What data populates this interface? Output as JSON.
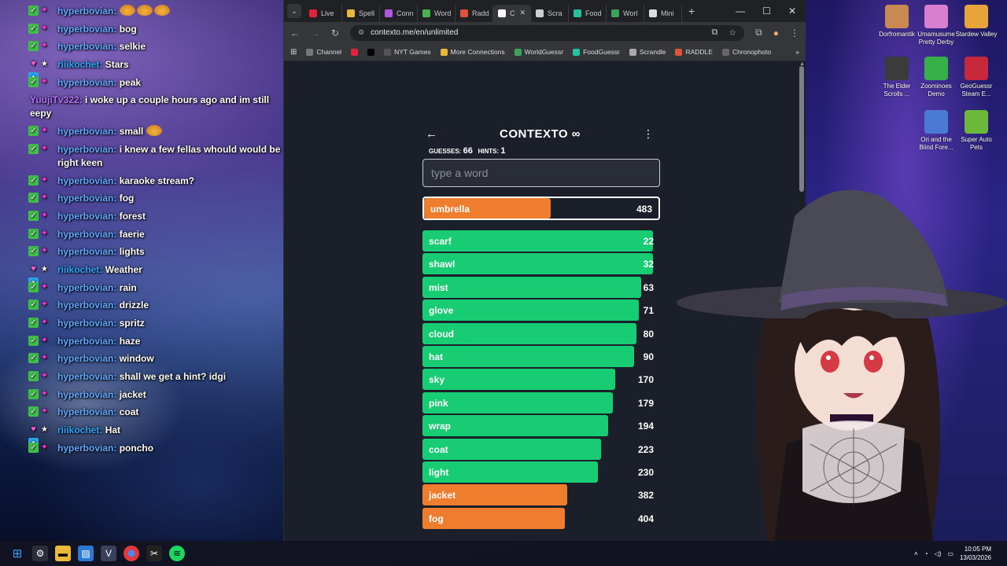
{
  "chat": {
    "messages": [
      {
        "user": "hyperbovian:",
        "text": "",
        "emote": true,
        "badges": "check-sub"
      },
      {
        "user": "hyperbovian:",
        "text": "bog",
        "badges": "check-sub"
      },
      {
        "user": "hyperbovian:",
        "text": "selkie",
        "badges": "check-sub"
      },
      {
        "user": "riiikochet:",
        "text": "Stars",
        "badges": "heart-star-vip"
      },
      {
        "user": "hyperbovian:",
        "text": "peak",
        "badges": "check-sub"
      },
      {
        "user": "YuujiTv322:",
        "text": "i woke up a couple hours ago and im still eepy",
        "badges": "none"
      },
      {
        "user": "hyperbovian:",
        "text": "small",
        "emote_after": true,
        "badges": "check-sub"
      },
      {
        "user": "hyperbovian:",
        "text": "i knew a few fellas whould would be right keen",
        "badges": "check-sub"
      },
      {
        "user": "hyperbovian:",
        "text": "karaoke stream?",
        "badges": "check-sub"
      },
      {
        "user": "hyperbovian:",
        "text": "fog",
        "badges": "check-sub"
      },
      {
        "user": "hyperbovian:",
        "text": "forest",
        "badges": "check-sub"
      },
      {
        "user": "hyperbovian:",
        "text": "faerie",
        "badges": "check-sub"
      },
      {
        "user": "hyperbovian:",
        "text": "lights",
        "badges": "check-sub"
      },
      {
        "user": "riiikochet:",
        "text": "Weather",
        "badges": "heart-star-vip"
      },
      {
        "user": "hyperbovian:",
        "text": "rain",
        "badges": "check-sub"
      },
      {
        "user": "hyperbovian:",
        "text": "drizzle",
        "badges": "check-sub"
      },
      {
        "user": "hyperbovian:",
        "text": "spritz",
        "badges": "check-sub"
      },
      {
        "user": "hyperbovian:",
        "text": "haze",
        "badges": "check-sub"
      },
      {
        "user": "hyperbovian:",
        "text": "window",
        "badges": "check-sub"
      },
      {
        "user": "hyperbovian:",
        "text": "shall we get a hint? idgi",
        "badges": "check-sub"
      },
      {
        "user": "hyperbovian:",
        "text": "jacket",
        "badges": "check-sub"
      },
      {
        "user": "hyperbovian:",
        "text": "coat",
        "badges": "check-sub"
      },
      {
        "user": "riiikochet:",
        "text": "Hat",
        "badges": "heart-star-vip"
      },
      {
        "user": "hyperbovian:",
        "text": "poncho",
        "badges": "check-sub"
      }
    ]
  },
  "browser": {
    "tabs": [
      {
        "label": "Live",
        "color": "#e0223a"
      },
      {
        "label": "Spell",
        "color": "#e9b93a"
      },
      {
        "label": "Conn",
        "color": "#b058e0"
      },
      {
        "label": "Word",
        "color": "#4caf50"
      },
      {
        "label": "Radd",
        "color": "#e0533a"
      },
      {
        "label": "C",
        "color": "#ffffff",
        "active": true
      },
      {
        "label": "Scra",
        "color": "#cfcfcf"
      },
      {
        "label": "Food",
        "color": "#24c2a0"
      },
      {
        "label": "Worl",
        "color": "#3aa35c"
      },
      {
        "label": "Mini",
        "color": "#dddddd"
      }
    ],
    "url": "contexto.me/en/unlimited",
    "bookmarks": [
      {
        "label": "Channel",
        "color": "#777"
      },
      {
        "label": "",
        "color": "#e0223a"
      },
      {
        "label": "",
        "color": "#000"
      },
      {
        "label": "NYT Games",
        "color": "#555"
      },
      {
        "label": "More Connections",
        "color": "#e9b93a"
      },
      {
        "label": "WorldGuessr",
        "color": "#3aa35c"
      },
      {
        "label": "FoodGuessr",
        "color": "#24c2a0"
      },
      {
        "label": "Scrandle",
        "color": "#aaa"
      },
      {
        "label": "RADDLE",
        "color": "#e0533a"
      },
      {
        "label": "Chronophoto",
        "color": "#666"
      }
    ]
  },
  "game": {
    "title": "CONTEXTO ∞",
    "guesses_label": "GUESSES:",
    "guesses": "66",
    "hints_label": "HINTS:",
    "hints": "1",
    "placeholder": "type a word",
    "last_guess": {
      "word": "umbrella",
      "rank": 483,
      "fill": 0.54,
      "color": "orange"
    },
    "guesses_list": [
      {
        "word": "scarf",
        "rank": 22,
        "fill": 0.97,
        "color": "green"
      },
      {
        "word": "shawl",
        "rank": 32,
        "fill": 0.97,
        "color": "green"
      },
      {
        "word": "mist",
        "rank": 63,
        "fill": 0.92,
        "color": "green"
      },
      {
        "word": "glove",
        "rank": 71,
        "fill": 0.91,
        "color": "green"
      },
      {
        "word": "cloud",
        "rank": 80,
        "fill": 0.9,
        "color": "green"
      },
      {
        "word": "hat",
        "rank": 90,
        "fill": 0.89,
        "color": "green"
      },
      {
        "word": "sky",
        "rank": 170,
        "fill": 0.81,
        "color": "green"
      },
      {
        "word": "pink",
        "rank": 179,
        "fill": 0.8,
        "color": "green"
      },
      {
        "word": "wrap",
        "rank": 194,
        "fill": 0.78,
        "color": "green"
      },
      {
        "word": "coat",
        "rank": 223,
        "fill": 0.75,
        "color": "green"
      },
      {
        "word": "light",
        "rank": 230,
        "fill": 0.74,
        "color": "green"
      },
      {
        "word": "jacket",
        "rank": 382,
        "fill": 0.61,
        "color": "orange"
      },
      {
        "word": "fog",
        "rank": 404,
        "fill": 0.6,
        "color": "orange"
      }
    ]
  },
  "desktop_icons": [
    {
      "label": "Dorfromantik",
      "color": "#c98a52"
    },
    {
      "label": "Umamusume Pretty Derby",
      "color": "#d97fd0"
    },
    {
      "label": "Stardew Valley",
      "color": "#e7a43b"
    },
    {
      "label": "The Elder Scrolls ...",
      "color": "#3b3b3b"
    },
    {
      "label": "Zoominoes Demo",
      "color": "#38b04a"
    },
    {
      "label": "GeoGuessr Steam E...",
      "color": "#c8283c"
    },
    {
      "label": "Ori and the Blind Fore...",
      "color": "#4a7ad4"
    },
    {
      "label": "Super Auto Pets",
      "color": "#6bb83a"
    }
  ],
  "taskbar": {
    "time": "10:05 PM",
    "date": "13/03/2026"
  }
}
